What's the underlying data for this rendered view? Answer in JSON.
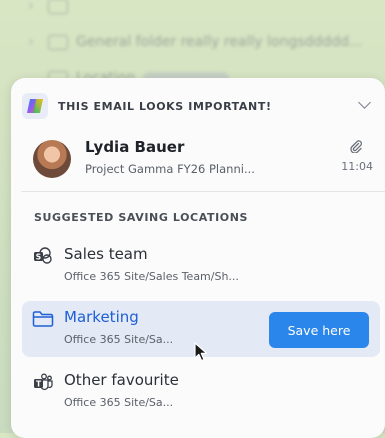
{
  "background_list": {
    "items": [
      {
        "label": ""
      },
      {
        "label": "General folder really really longsddddd..."
      },
      {
        "label": "Location"
      }
    ]
  },
  "header": {
    "title": "THIS EMAIL LOOKS IMPORTANT!",
    "icon": "copilot-logo-icon"
  },
  "email": {
    "sender": "Lydia Bauer",
    "subject": "Project Gamma FY26 Planni...",
    "time": "11:04",
    "attachment_icon": "paperclip-icon"
  },
  "suggestions": {
    "section_label": "SUGGESTED SAVING LOCATIONS",
    "items": [
      {
        "name": "Sales team",
        "path": "Office 365 Site/Sales Team/Sh...",
        "icon": "sharepoint-icon"
      },
      {
        "name": "Marketing",
        "path": "Office 365 Site/Sa...",
        "icon": "folder-icon",
        "selected": true
      },
      {
        "name": "Other favourite",
        "path": "Office 365 Site/Sa...",
        "icon": "teams-icon"
      }
    ],
    "save_label": "Save here"
  },
  "colors": {
    "accent": "#2a86ea",
    "selected_bg": "#e3e9f5",
    "selected_text": "#1d5fd6"
  }
}
